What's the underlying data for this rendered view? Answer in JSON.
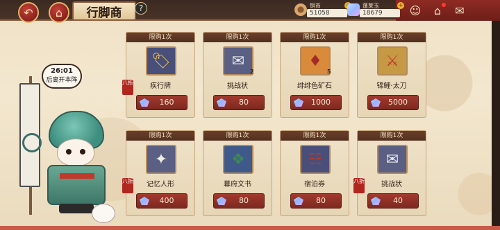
{
  "header": {
    "back_icon": "back-arrow-icon",
    "home_icon": "shop-house-icon",
    "title": "行脚商",
    "help_label": "?"
  },
  "currencies": [
    {
      "label": "铜币",
      "value": "51058",
      "icon": "copper-coin-icon",
      "plus": "+"
    },
    {
      "label": "蓬莱玉",
      "value": "18679",
      "icon": "jade-gem-icon",
      "plus": "+"
    }
  ],
  "top_actions": [
    {
      "icon": "character-icon"
    },
    {
      "icon": "home-icon"
    },
    {
      "icon": "mail-icon"
    }
  ],
  "character": {
    "timer": "26:01",
    "timer_note": "后离开本阵"
  },
  "items": [
    {
      "tag": "限购1次",
      "name": "疾行牌",
      "price": "160",
      "count": "",
      "discount": "八折",
      "icon": "tag-icon",
      "icon_bg": "#4a4f7a",
      "icon_color": "#f2c84b"
    },
    {
      "tag": "限购1次",
      "name": "挑战状",
      "price": "80",
      "count": "2",
      "discount": "",
      "icon": "envelope-icon",
      "icon_bg": "#5a5f83",
      "icon_color": "#e8e8ea"
    },
    {
      "tag": "限购1次",
      "name": "绯绯色矿石",
      "price": "1000",
      "count": "5",
      "discount": "",
      "icon": "ore-icon",
      "icon_bg": "#d98a3b",
      "icon_color": "#a52a25"
    },
    {
      "tag": "限购1次",
      "name": "锦鲤·太刀",
      "price": "5000",
      "count": "",
      "discount": "",
      "icon": "koi-sword-icon",
      "icon_bg": "#c69a45",
      "icon_color": "#c0392b"
    },
    {
      "tag": "限购1次",
      "name": "记忆人形",
      "price": "400",
      "count": "",
      "discount": "八折",
      "icon": "paper-doll-icon",
      "icon_bg": "#5a5f83",
      "icon_color": "#f1ece2"
    },
    {
      "tag": "限购1次",
      "name": "幕府文书",
      "price": "80",
      "count": "",
      "discount": "",
      "icon": "scroll-book-icon",
      "icon_bg": "#3f5a8a",
      "icon_color": "#3c8a4a"
    },
    {
      "tag": "限购1次",
      "name": "宿泊券",
      "price": "80",
      "count": "",
      "discount": "",
      "icon": "ticket-icon",
      "icon_bg": "#4a4f7a",
      "icon_color": "#b13a2e"
    },
    {
      "tag": "限购1次",
      "name": "挑战状",
      "price": "40",
      "count": "",
      "discount": "八折",
      "icon": "envelope-icon",
      "icon_bg": "#5a5f83",
      "icon_color": "#e8e8ea"
    }
  ]
}
